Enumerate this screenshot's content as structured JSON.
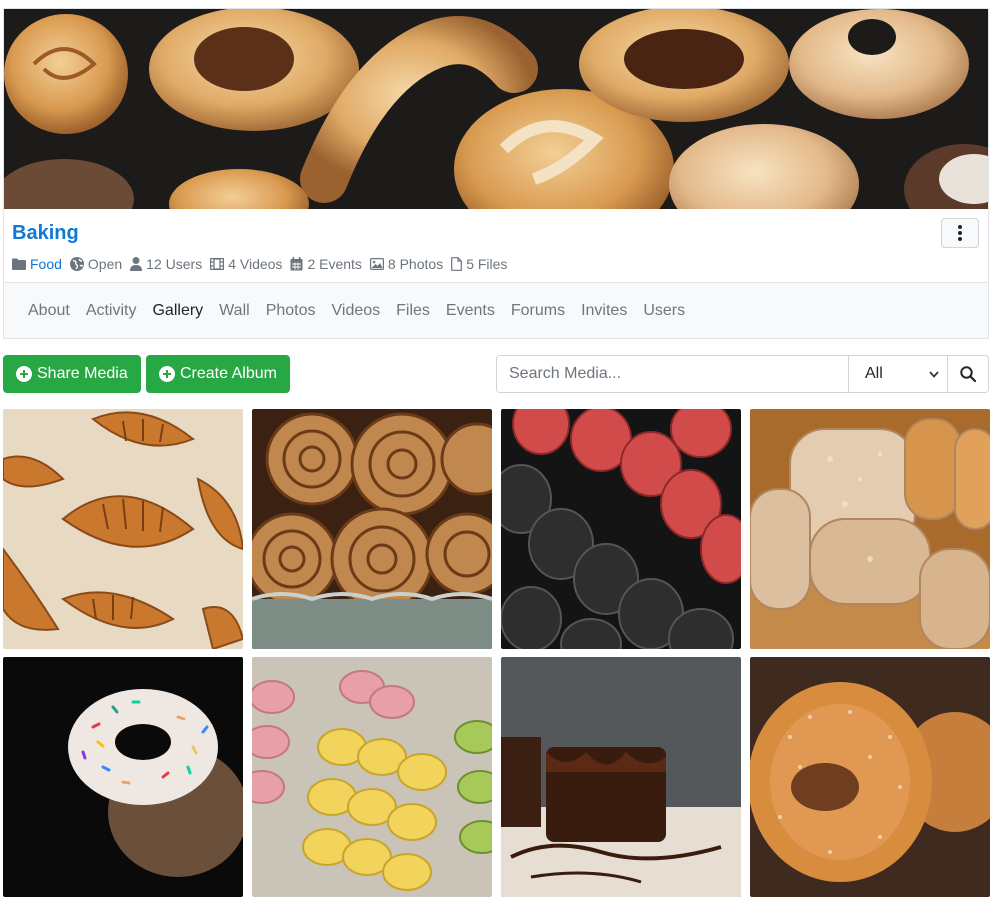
{
  "group": {
    "name": "Baking",
    "meta": {
      "category": "Food",
      "privacy": "Open",
      "users": "12 Users",
      "videos": "4 Videos",
      "events": "2 Events",
      "photos": "8 Photos",
      "files": "5 Files"
    },
    "tabs": [
      "About",
      "Activity",
      "Gallery",
      "Wall",
      "Photos",
      "Videos",
      "Files",
      "Events",
      "Forums",
      "Invites",
      "Users"
    ],
    "active_tab": "Gallery"
  },
  "toolbar": {
    "share_media_label": "Share Media",
    "create_album_label": "Create Album",
    "search_placeholder": "Search Media...",
    "filter_selected": "All"
  },
  "colors": {
    "brand_link": "#0d7ad6",
    "action_green": "#28a745"
  },
  "icons": {
    "menu": "vertical-dots-icon",
    "category": "folder-icon",
    "privacy": "globe-icon",
    "users": "user-icon",
    "videos": "film-icon",
    "events": "calendar-icon",
    "photos": "image-icon",
    "files": "file-icon",
    "add": "plus-circle-icon",
    "search": "magnifier-icon",
    "select": "chevron-down-icon"
  },
  "gallery": {
    "photo_subjects": [
      "croissants",
      "cinnamon-rolls",
      "macarons-red-black",
      "bread-loaves",
      "sprinkle-donut",
      "macaron-display",
      "chocolate-brownie",
      "sugar-donut"
    ]
  }
}
